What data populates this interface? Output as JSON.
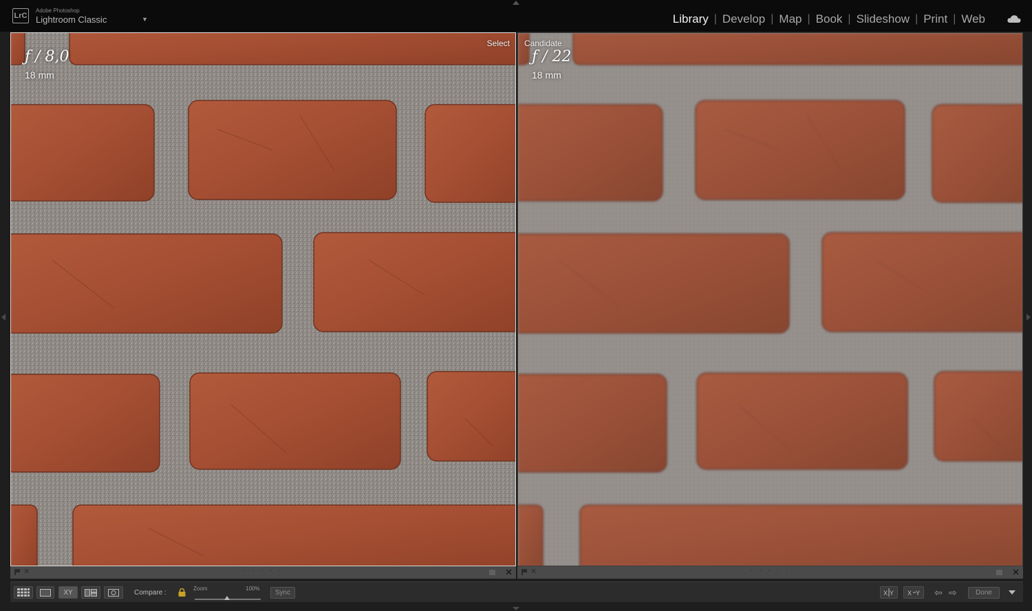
{
  "app": {
    "vendor": "Adobe Photoshop",
    "name": "Lightroom Classic",
    "logo": "LrC"
  },
  "modules": [
    {
      "label": "Library",
      "active": true
    },
    {
      "label": "Develop",
      "active": false
    },
    {
      "label": "Map",
      "active": false
    },
    {
      "label": "Book",
      "active": false
    },
    {
      "label": "Slideshow",
      "active": false
    },
    {
      "label": "Print",
      "active": false
    },
    {
      "label": "Web",
      "active": false
    }
  ],
  "compare": {
    "select": {
      "tag": "Select",
      "aperture": "ƒ / 8,0",
      "focal": "18 mm"
    },
    "candidate": {
      "tag": "Candidate",
      "aperture": "ƒ / 22",
      "focal": "18 mm"
    },
    "pane_footer_dots": "· · · · ·",
    "close_glyph": "✕",
    "reject_glyph": "✕"
  },
  "toolbar": {
    "compare_label": "Compare :",
    "zoom_label": "Zoom",
    "zoom_value": "100%",
    "zoom_level": 0.5,
    "sync_label": "Sync",
    "done_label": "Done",
    "xy_label": "XY",
    "prev_arrow": "⇦",
    "next_arrow": "⇨"
  },
  "colors": {
    "brick": "#a44e33",
    "mortar": "#8f8a86",
    "active_module": "#f2f2f2",
    "select_border": "#d9d9d9"
  }
}
